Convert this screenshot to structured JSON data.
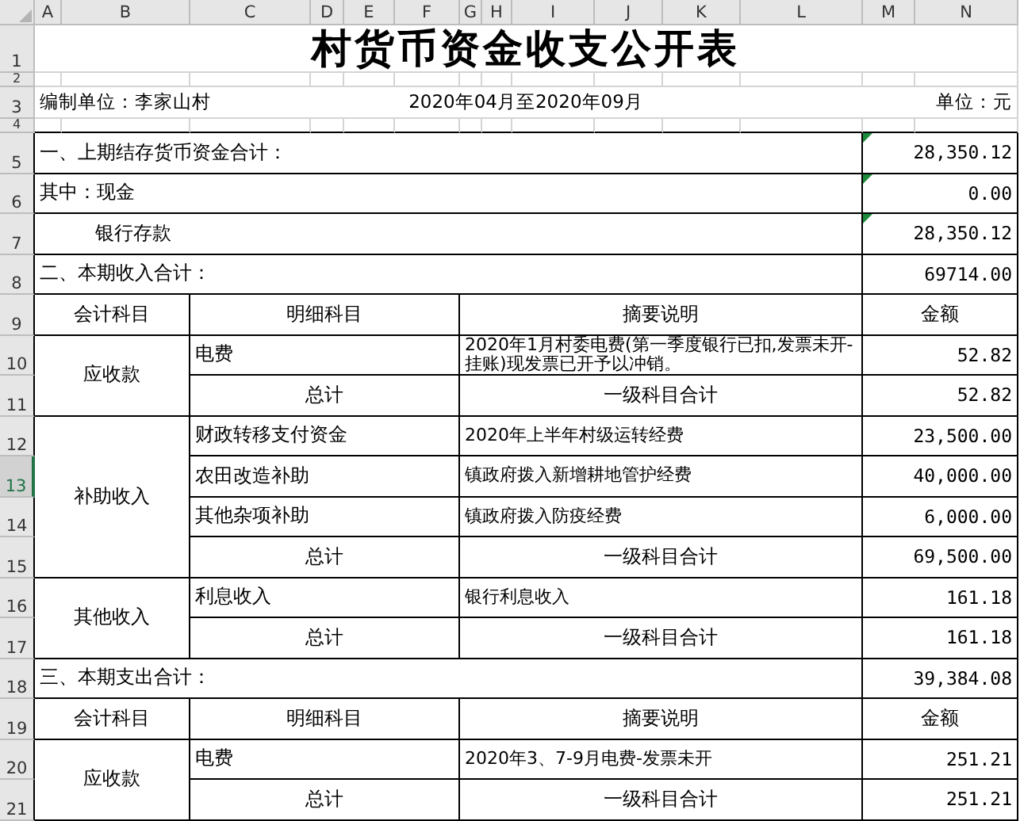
{
  "sheet": {
    "column_headers": [
      "A",
      "B",
      "C",
      "D",
      "E",
      "F",
      "G",
      "H",
      "I",
      "J",
      "K",
      "L",
      "M",
      "N"
    ],
    "row_headers": [
      {
        "label": "1",
        "selected": false
      },
      {
        "label": "2",
        "selected": false
      },
      {
        "label": "3",
        "selected": false
      },
      {
        "label": "4",
        "selected": false
      },
      {
        "label": "5",
        "selected": false
      },
      {
        "label": "6",
        "selected": false
      },
      {
        "label": "7",
        "selected": false
      },
      {
        "label": "8",
        "selected": false
      },
      {
        "label": "9",
        "selected": false
      },
      {
        "label": "10",
        "selected": false
      },
      {
        "label": "11",
        "selected": false
      },
      {
        "label": "12",
        "selected": false
      },
      {
        "label": "13",
        "selected": true
      },
      {
        "label": "14",
        "selected": false
      },
      {
        "label": "15",
        "selected": false
      },
      {
        "label": "16",
        "selected": false
      },
      {
        "label": "17",
        "selected": false
      },
      {
        "label": "18",
        "selected": false
      },
      {
        "label": "19",
        "selected": false
      },
      {
        "label": "20",
        "selected": false
      },
      {
        "label": "21",
        "selected": false
      }
    ]
  },
  "title": "村货币资金收支公开表",
  "info": {
    "unit_org": "编制单位：李家山村",
    "period": "2020年04月至2020年09月",
    "currency_unit": "单位：元"
  },
  "blocks": [
    {
      "kind": "line",
      "label": "一、上期结存货币资金合计：",
      "amount": "28,350.12",
      "indented": false,
      "flagged": true
    },
    {
      "kind": "line",
      "label": "其中：现金",
      "amount": "0.00",
      "indented": false,
      "flagged": true
    },
    {
      "kind": "line",
      "label": "银行存款",
      "amount": "28,350.12",
      "indented": true,
      "flagged": true
    },
    {
      "kind": "line",
      "label": "二、本期收入合计：",
      "amount": "69714.00",
      "indented": false,
      "flagged": false
    },
    {
      "kind": "header",
      "account": "会计科目",
      "detail": "明细科目",
      "description": "摘要说明",
      "amount": "金额"
    },
    {
      "kind": "group",
      "account": "应收款",
      "items": [
        {
          "detail": "电费",
          "description": "2020年1月村委电费(第一季度银行已扣,发票未开-挂账)现发票已开予以冲销。",
          "amount": "52.82"
        }
      ],
      "total": {
        "label": "总计",
        "description": "一级科目合计",
        "amount": "52.82"
      }
    },
    {
      "kind": "group",
      "account": "补助收入",
      "items": [
        {
          "detail": "财政转移支付资金",
          "description": "2020年上半年村级运转经费",
          "amount": "23,500.00"
        },
        {
          "detail": "农田改造补助",
          "description": "镇政府拨入新增耕地管护经费",
          "amount": "40,000.00"
        },
        {
          "detail": "其他杂项补助",
          "description": "镇政府拨入防疫经费",
          "amount": "6,000.00"
        }
      ],
      "total": {
        "label": "总计",
        "description": "一级科目合计",
        "amount": "69,500.00"
      }
    },
    {
      "kind": "group",
      "account": "其他收入",
      "items": [
        {
          "detail": "利息收入",
          "description": "银行利息收入",
          "amount": "161.18"
        }
      ],
      "total": {
        "label": "总计",
        "description": "一级科目合计",
        "amount": "161.18"
      }
    },
    {
      "kind": "line",
      "label": "三、本期支出合计：",
      "amount": "39,384.08",
      "indented": false,
      "flagged": false
    },
    {
      "kind": "header",
      "account": "会计科目",
      "detail": "明细科目",
      "description": "摘要说明",
      "amount": "金额"
    },
    {
      "kind": "group",
      "account": "应收款",
      "items": [
        {
          "detail": "电费",
          "description": "2020年3、7-9月电费-发票未开",
          "amount": "251.21"
        }
      ],
      "total": {
        "label": "总计",
        "description": "一级科目合计",
        "amount": "251.21"
      }
    }
  ]
}
